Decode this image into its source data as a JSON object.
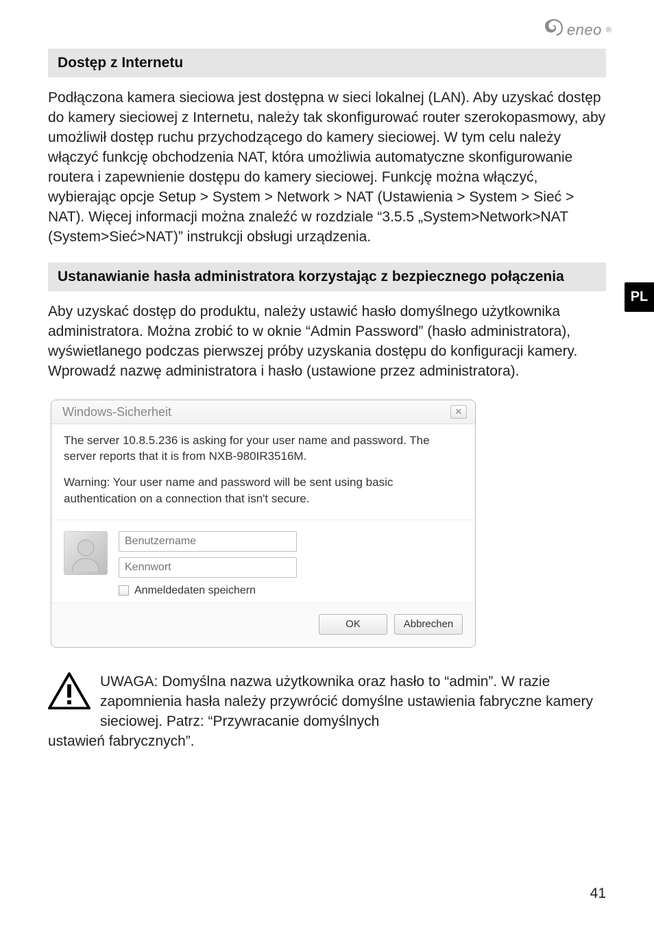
{
  "brand": {
    "name": "eneo"
  },
  "lang_tab": "PL",
  "sections": {
    "s1": {
      "title": "Dostęp z Internetu",
      "body": "Podłączona kamera sieciowa jest dostępna w sieci lokalnej (LAN). Aby uzyskać dostęp do kamery sieciowej z Internetu, należy tak skonfigurować router szerokopasmowy, aby umożliwił dostęp ruchu przychodzącego do kamery sieciowej. W tym celu należy włączyć funkcję obchodzenia NAT, która umożliwia automatyczne skonfigurowanie routera i zapewnienie dostępu do kamery sieciowej. Funkcję można włączyć, wybierając opcje Setup > System > Network > NAT (Ustawienia > System > Sieć > NAT). Więcej informacji można znaleźć w rozdziale “3.5.5 „System>Network>NAT (System>Sieć>NAT)” instrukcji obsługi urządzenia."
    },
    "s2": {
      "title": "Ustanawianie hasła administratora korzystając z bezpiecznego połączenia",
      "body": "Aby uzyskać dostęp do produktu, należy ustawić hasło domyślnego użytkownika administratora. Można zrobić to w oknie “Admin Password” (hasło administratora), wyświetlanego podczas pierwszej próby uzyskania dostępu do konfiguracji kamery. Wprowadź nazwę administratora i hasło (ustawione przez administratora)."
    }
  },
  "dialog": {
    "title": "Windows-Sicherheit",
    "p1": "The server 10.8.5.236 is asking for your user name and password. The server reports that it is from NXB-980IR3516M.",
    "p2": "Warning: Your user name and password will be sent using basic authentication on a connection that isn't secure.",
    "user_placeholder": "Benutzername",
    "pass_placeholder": "Kennwort",
    "remember": "Anmeldedaten speichern",
    "ok": "OK",
    "cancel": "Abbrechen"
  },
  "note": {
    "line1": "UWAGA: Domyślna nazwa użytkownika oraz hasło to “admin”. W razie zapomnienia hasła należy przywrócić domyślne ustawienia fabryczne kamery sieciowej. Patrz: “Przywracanie domyślnych",
    "line2": "ustawień fabrycznych”."
  },
  "page_number": "41"
}
